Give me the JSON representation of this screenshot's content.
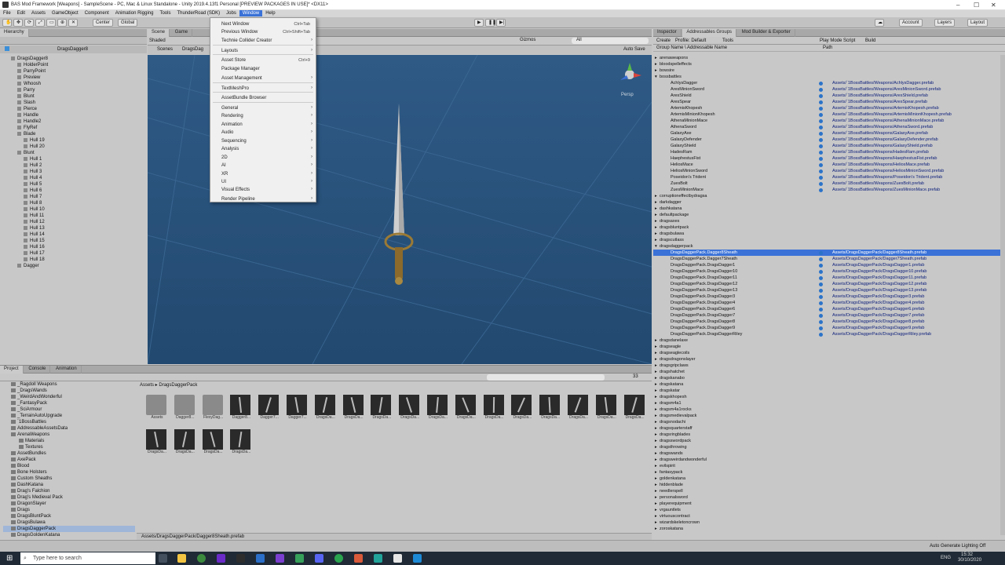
{
  "window": {
    "title": "BAS Mod Framework [Weapons] - SampleScene - PC, Mac & Linux Standalone - Unity 2019.4.13f1 Personal [PREVIEW PACKAGES IN USE]* <DX11>"
  },
  "menubar": [
    "File",
    "Edit",
    "Assets",
    "GameObject",
    "Component",
    "Animation Rigging",
    "Tools",
    "ThunderRoad (SDK)",
    "Jobs",
    "Window",
    "Help"
  ],
  "toolbar": {
    "center": "Center",
    "global": "Global",
    "account": "Account",
    "layers": "Layers",
    "layout": "Layout"
  },
  "hierarchy": {
    "tab": "Hierarchy",
    "root": "DragsDagger8",
    "items": [
      {
        "t": "DragsDagger8",
        "d": 0
      },
      {
        "t": "HolderPoint",
        "d": 1
      },
      {
        "t": "ParryPoint",
        "d": 1
      },
      {
        "t": "Preview",
        "d": 1
      },
      {
        "t": "Whoosh",
        "d": 1
      },
      {
        "t": "Parry",
        "d": 1
      },
      {
        "t": "Blunt",
        "d": 1
      },
      {
        "t": "Slash",
        "d": 1
      },
      {
        "t": "Pierce",
        "d": 1
      },
      {
        "t": "Handle",
        "d": 1
      },
      {
        "t": "Handle2",
        "d": 1
      },
      {
        "t": "FlyRef",
        "d": 1
      },
      {
        "t": "Blade",
        "d": 1
      },
      {
        "t": "Hull 19",
        "d": 2
      },
      {
        "t": "Hull 20",
        "d": 2
      },
      {
        "t": "Blunt",
        "d": 1
      },
      {
        "t": "Hull 1",
        "d": 2
      },
      {
        "t": "Hull 2",
        "d": 2
      },
      {
        "t": "Hull 3",
        "d": 2
      },
      {
        "t": "Hull 4",
        "d": 2
      },
      {
        "t": "Hull 5",
        "d": 2
      },
      {
        "t": "Hull 6",
        "d": 2
      },
      {
        "t": "Hull 7",
        "d": 2
      },
      {
        "t": "Hull 8",
        "d": 2
      },
      {
        "t": "Hull 10",
        "d": 2
      },
      {
        "t": "Hull 11",
        "d": 2
      },
      {
        "t": "Hull 12",
        "d": 2
      },
      {
        "t": "Hull 13",
        "d": 2
      },
      {
        "t": "Hull 14",
        "d": 2
      },
      {
        "t": "Hull 15",
        "d": 2
      },
      {
        "t": "Hull 16",
        "d": 2
      },
      {
        "t": "Hull 17",
        "d": 2
      },
      {
        "t": "Hull 18",
        "d": 2
      },
      {
        "t": "Dagger",
        "d": 1
      }
    ]
  },
  "scene": {
    "tabs": [
      "Scene",
      "Game"
    ],
    "shaded": "Shaded",
    "scenes": "Scenes",
    "breadcrumb": "DragsDag",
    "auto_save": "Auto Save",
    "persp": "Persp",
    "gizmos": "Gizmos",
    "search": "All"
  },
  "window_menu": {
    "items": [
      {
        "label": "Next Window",
        "shortcut": "Ctrl+Tab",
        "arrow": false
      },
      {
        "label": "Previous Window",
        "shortcut": "Ctrl+Shift+Tab",
        "arrow": false
      },
      {
        "label": "Technie Collider Creator",
        "shortcut": "",
        "arrow": true
      },
      {
        "label": "Layouts",
        "shortcut": "",
        "arrow": true
      },
      {
        "label": "Asset Store",
        "shortcut": "Ctrl+9",
        "arrow": false
      },
      {
        "label": "Package Manager",
        "shortcut": "",
        "arrow": false
      },
      {
        "label": "Asset Management",
        "shortcut": "",
        "arrow": true
      },
      {
        "label": "TextMeshPro",
        "shortcut": "",
        "arrow": true
      },
      {
        "label": "AssetBundle Browser",
        "shortcut": "",
        "arrow": false
      },
      {
        "label": "General",
        "shortcut": "",
        "arrow": true
      },
      {
        "label": "Rendering",
        "shortcut": "",
        "arrow": true
      },
      {
        "label": "Animation",
        "shortcut": "",
        "arrow": true
      },
      {
        "label": "Audio",
        "shortcut": "",
        "arrow": true
      },
      {
        "label": "Sequencing",
        "shortcut": "",
        "arrow": true
      },
      {
        "label": "Analysis",
        "shortcut": "",
        "arrow": true
      },
      {
        "label": "2D",
        "shortcut": "",
        "arrow": true
      },
      {
        "label": "AI",
        "shortcut": "",
        "arrow": true
      },
      {
        "label": "XR",
        "shortcut": "",
        "arrow": true
      },
      {
        "label": "UI",
        "shortcut": "",
        "arrow": true
      },
      {
        "label": "Visual Effects",
        "shortcut": "",
        "arrow": true
      },
      {
        "label": "Render Pipeline",
        "shortcut": "",
        "arrow": true
      }
    ]
  },
  "right_panel": {
    "tabs": [
      "Inspector",
      "Addressables Groups",
      "Mod Builder & Exporter"
    ],
    "create": "Create",
    "profile": "Profile: Default",
    "tools": "Tools",
    "play_mode": "Play Mode Script",
    "build": "Build",
    "col_group": "Group Name \\ Addressable Name",
    "col_path": "Path",
    "groups_top": [
      "arenaweapons",
      "bloodspelleffects",
      "bowsire",
      "bossbattles"
    ],
    "boss_items": [
      {
        "n": "AchlysDagger",
        "p": "Assets/`1BossBattles/Weapons/AchlysDagger.prefab"
      },
      {
        "n": "AresMinionSword",
        "p": "Assets/`1BossBattles/Weapons/AresMinionSword.prefab"
      },
      {
        "n": "AresShield",
        "p": "Assets/`1BossBattles/Weapons/AresShield.prefab"
      },
      {
        "n": "AresSpear",
        "p": "Assets/`1BossBattles/Weapons/AresSpear.prefab"
      },
      {
        "n": "ArtemisKhopesh",
        "p": "Assets/`1BossBattles/Weapons/ArtemisKhopesh.prefab"
      },
      {
        "n": "ArtemisMinionKhopesh",
        "p": "Assets/`1BossBattles/Weapons/ArtemisMinionKhopesh.prefab"
      },
      {
        "n": "AthenaMinionMace",
        "p": "Assets/`1BossBattles/Weapons/AthenaMinionMace.prefab"
      },
      {
        "n": "AthenaSword",
        "p": "Assets/`1BossBattles/Weapons/AthenaSword.prefab"
      },
      {
        "n": "GalaxyAxe",
        "p": "Assets/`1BossBattles/Weapons/GalaxyAxe.prefab"
      },
      {
        "n": "GalaxyDefender",
        "p": "Assets/`1BossBattles/Weapons/GalaxyDefender.prefab"
      },
      {
        "n": "GalaxyShield",
        "p": "Assets/`1BossBattles/Weapons/GalaxyShield.prefab"
      },
      {
        "n": "HadesRam",
        "p": "Assets/`1BossBattles/Weapons/HadesRam.prefab"
      },
      {
        "n": "HaephestusFist",
        "p": "Assets/`1BossBattles/Weapons/HaephestusFist.prefab"
      },
      {
        "n": "HeliosMace",
        "p": "Assets/`1BossBattles/Weapons/HeliosMace.prefab"
      },
      {
        "n": "HeliosMinionSword",
        "p": "Assets/`1BossBattles/Weapons/HeliosMinionSword.prefab"
      },
      {
        "n": "Poseidon's Trident",
        "p": "Assets/`1BossBattles/Weapons/Poseidon's Trident.prefab"
      },
      {
        "n": "ZuesBolt",
        "p": "Assets/`1BossBattles/Weapons/ZuesBolt.prefab"
      },
      {
        "n": "ZuesMinionMace",
        "p": "Assets/`1BossBattles/Weapons/ZuesMinionMace.prefab"
      }
    ],
    "groups_mid": [
      "corruptioneffectbydragsa",
      "darkdagger",
      "dashkatana",
      "defaultpackage",
      "dragsaxes",
      "dragsbluntpack",
      "dragsbulawa",
      "dragscutlass",
      "dragsdaggerpack"
    ],
    "dagger_items": [
      {
        "n": "DragsDaggerPack.Dagger8Sheath",
        "p": "Assets/DragsDaggerPack/Dagger8Sheath.prefab",
        "sel": true
      },
      {
        "n": "DragsDaggerPack.Dagger7Sheath",
        "p": "Assets/DragsDaggerPack/Dagger7Sheath.prefab"
      },
      {
        "n": "DragsDaggerPack.DragsDagger1",
        "p": "Assets/DragsDaggerPack/DragsDagger1.prefab"
      },
      {
        "n": "DragsDaggerPack.DragsDagger10",
        "p": "Assets/DragsDaggerPack/DragsDagger10.prefab"
      },
      {
        "n": "DragsDaggerPack.DragsDagger11",
        "p": "Assets/DragsDaggerPack/DragsDagger11.prefab"
      },
      {
        "n": "DragsDaggerPack.DragsDagger12",
        "p": "Assets/DragsDaggerPack/DragsDagger12.prefab"
      },
      {
        "n": "DragsDaggerPack.DragsDagger13",
        "p": "Assets/DragsDaggerPack/DragsDagger13.prefab"
      },
      {
        "n": "DragsDaggerPack.DragsDagger3",
        "p": "Assets/DragsDaggerPack/DragsDagger3.prefab"
      },
      {
        "n": "DragsDaggerPack.DragsDagger4",
        "p": "Assets/DragsDaggerPack/DragsDagger4.prefab"
      },
      {
        "n": "DragsDaggerPack.DragsDagger6",
        "p": "Assets/DragsDaggerPack/DragsDagger6.prefab"
      },
      {
        "n": "DragsDaggerPack.DragsDagger7",
        "p": "Assets/DragsDaggerPack/DragsDagger7.prefab"
      },
      {
        "n": "DragsDaggerPack.DragsDagger8",
        "p": "Assets/DragsDaggerPack/DragsDagger8.prefab"
      },
      {
        "n": "DragsDaggerPack.DragsDagger9",
        "p": "Assets/DragsDaggerPack/DragsDagger9.prefab"
      },
      {
        "n": "DragsDaggerPack.DragsDaggerRiley",
        "p": "Assets/DragsDaggerPack/DragsDaggerRiley.prefab"
      }
    ],
    "groups_bottom": [
      "dragsdanelaxe",
      "dragseagle",
      "dragseaglecoils",
      "dragsdragonslayer",
      "dragsgripclaws",
      "dragshatchet",
      "dragskanabo",
      "dragskatana",
      "dragskatar",
      "dragskhopesh",
      "dragsm4a1",
      "dragsm4a1rocks",
      "dragsmedievalpack",
      "dragsnodachi",
      "dragsquarterstaff",
      "dragsringblades",
      "dragsswordpack",
      "dragsthrowing",
      "dragswands",
      "dragsweirdandwonderful",
      "evilspirit",
      "fantasypack",
      "goldenkatana",
      "hiddenblade",
      "needlerspell",
      "personalsword",
      "playerequipment",
      "vrgauntlets",
      "virtuouscontract",
      "wizardskeletoncrown",
      "zoroskatana"
    ]
  },
  "project": {
    "tabs": [
      "Project",
      "Console",
      "Animation"
    ],
    "breadcrumb_root": "Assets",
    "breadcrumb_leaf": "DragsDaggerPack",
    "status_path": "Assets/DragsDaggerPack/Dagger8Sheath.prefab",
    "count": "33",
    "tree": [
      "_Ragdoll Weapons",
      "_DragsWands",
      "_WeirdAndWonderful",
      "_FantasyPack",
      "_SciArmour",
      "_TerrainAutoUpgrade",
      "`1BossBattles",
      "AddressableAssetsData",
      "ArenaWeapons",
      "Materials",
      "Textures",
      "AssetBundles",
      "AxePack",
      "Blood",
      "Bone Holsters",
      "Custom Sheaths",
      "DashKatana",
      "Drag's Falchion",
      "Drag's Medieval Pack",
      "DragonSlayer",
      "Drags",
      "DragsBluntPack",
      "DragsBulawa",
      "DragsDaggerPack",
      "DragsGoldenKatana",
      "DragsGripWeapons"
    ],
    "assets": [
      "Assets",
      "Dagger8...",
      "FlexyDag...",
      "Dagger8...",
      "Dagger7...",
      "Dagger7...",
      "DragsDa...",
      "DragsDa...",
      "DragsDa...",
      "DragsDa...",
      "DragsDa...",
      "DragsDa...",
      "DragsDa...",
      "DragsDa...",
      "DragsDa...",
      "DragsDa...",
      "DragsDa...",
      "DragsDa...",
      "DragsDa...",
      "DragsDa...",
      "DragsDa...",
      "DragsDa..."
    ]
  },
  "bottom_status": "Auto Generate Lighting Off",
  "taskbar": {
    "search": "Type here to search",
    "time": "15:32",
    "date": "30/10/2020",
    "lang": "ENG"
  },
  "colors": {
    "selection": "#3a72d8",
    "scene_bg": "#2b5580",
    "taskbar": "#1f2a36"
  }
}
